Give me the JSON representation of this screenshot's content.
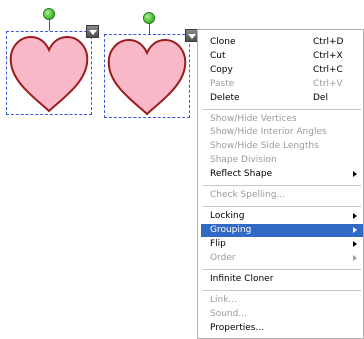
{
  "canvas": {
    "shapes": [
      {
        "name": "heart",
        "fill": "#f8b8c8",
        "stroke": "#9b1c1c",
        "selection_color": "#3c58d6"
      },
      {
        "name": "heart",
        "fill": "#f8b8c8",
        "stroke": "#9b1c1c",
        "selection_color": "#3c58d6"
      }
    ],
    "handle_icon": "rotation-handle-icon",
    "menu_button_icon": "shape-menu-arrow-icon"
  },
  "context_menu": {
    "selected_color": "#316ac5",
    "items": [
      {
        "label": "Clone",
        "shortcut": "Ctrl+D",
        "enabled": true
      },
      {
        "label": "Cut",
        "shortcut": "Ctrl+X",
        "enabled": true
      },
      {
        "label": "Copy",
        "shortcut": "Ctrl+C",
        "enabled": true
      },
      {
        "label": "Paste",
        "shortcut": "Ctrl+V",
        "enabled": false
      },
      {
        "label": "Delete",
        "shortcut": "Del",
        "enabled": true
      },
      {
        "label": "Show/Hide Vertices",
        "enabled": false
      },
      {
        "label": "Show/Hide Interior Angles",
        "enabled": false
      },
      {
        "label": "Show/Hide Side Lengths",
        "enabled": false
      },
      {
        "label": "Shape Division",
        "enabled": false
      },
      {
        "label": "Reflect Shape",
        "enabled": true,
        "submenu": true
      },
      {
        "label": "Check Spelling...",
        "enabled": false
      },
      {
        "label": "Locking",
        "enabled": true,
        "submenu": true
      },
      {
        "label": "Grouping",
        "enabled": true,
        "submenu": true,
        "selected": true
      },
      {
        "label": "Flip",
        "enabled": true,
        "submenu": true
      },
      {
        "label": "Order",
        "enabled": false,
        "submenu": true
      },
      {
        "label": "Infinite Cloner",
        "enabled": true
      },
      {
        "label": "Link...",
        "enabled": false
      },
      {
        "label": "Sound...",
        "enabled": false
      },
      {
        "label": "Properties...",
        "enabled": true
      }
    ]
  }
}
